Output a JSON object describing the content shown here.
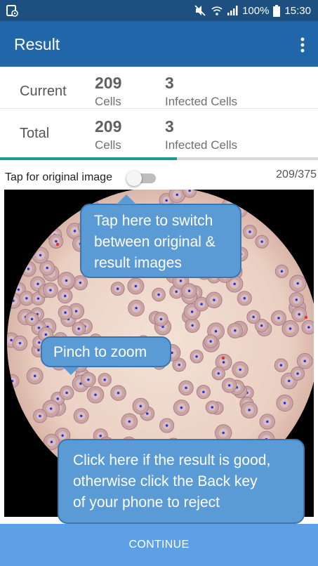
{
  "status_bar": {
    "battery": "100%",
    "time": "15:30",
    "icons": [
      "screenshot-notification-icon",
      "mute-icon",
      "wifi-icon",
      "signal-icon",
      "battery-icon"
    ]
  },
  "app_bar": {
    "title": "Result",
    "menu_icon": "more-vert-icon"
  },
  "stats": {
    "current": {
      "label": "Current",
      "cells": "209",
      "cells_unit": "Cells",
      "infected": "3",
      "infected_unit": "Infected Cells"
    },
    "total": {
      "label": "Total",
      "cells": "209",
      "cells_unit": "Cells",
      "infected": "3",
      "infected_unit": "Infected Cells"
    }
  },
  "progress": {
    "done": 209,
    "total": 375,
    "fraction": 0.557,
    "color": "#1e9a8a"
  },
  "image_toggle": {
    "label": "Tap for original image",
    "on": false,
    "counter": "209/375"
  },
  "callouts": {
    "switch": [
      "Tap here to switch",
      "between original &",
      "result images"
    ],
    "pinch": "Pinch to zoom",
    "continue": [
      "Click here if the result is good,",
      "otherwise click the Back key",
      "of your phone to reject"
    ]
  },
  "continue_button": {
    "label": "CONTINUE"
  },
  "colors": {
    "status_bar": "#1d4f80",
    "app_bar": "#2066a8",
    "accent": "#1e9a8a",
    "continue": "#5ea0e5",
    "callout": "#5b9bd5"
  }
}
